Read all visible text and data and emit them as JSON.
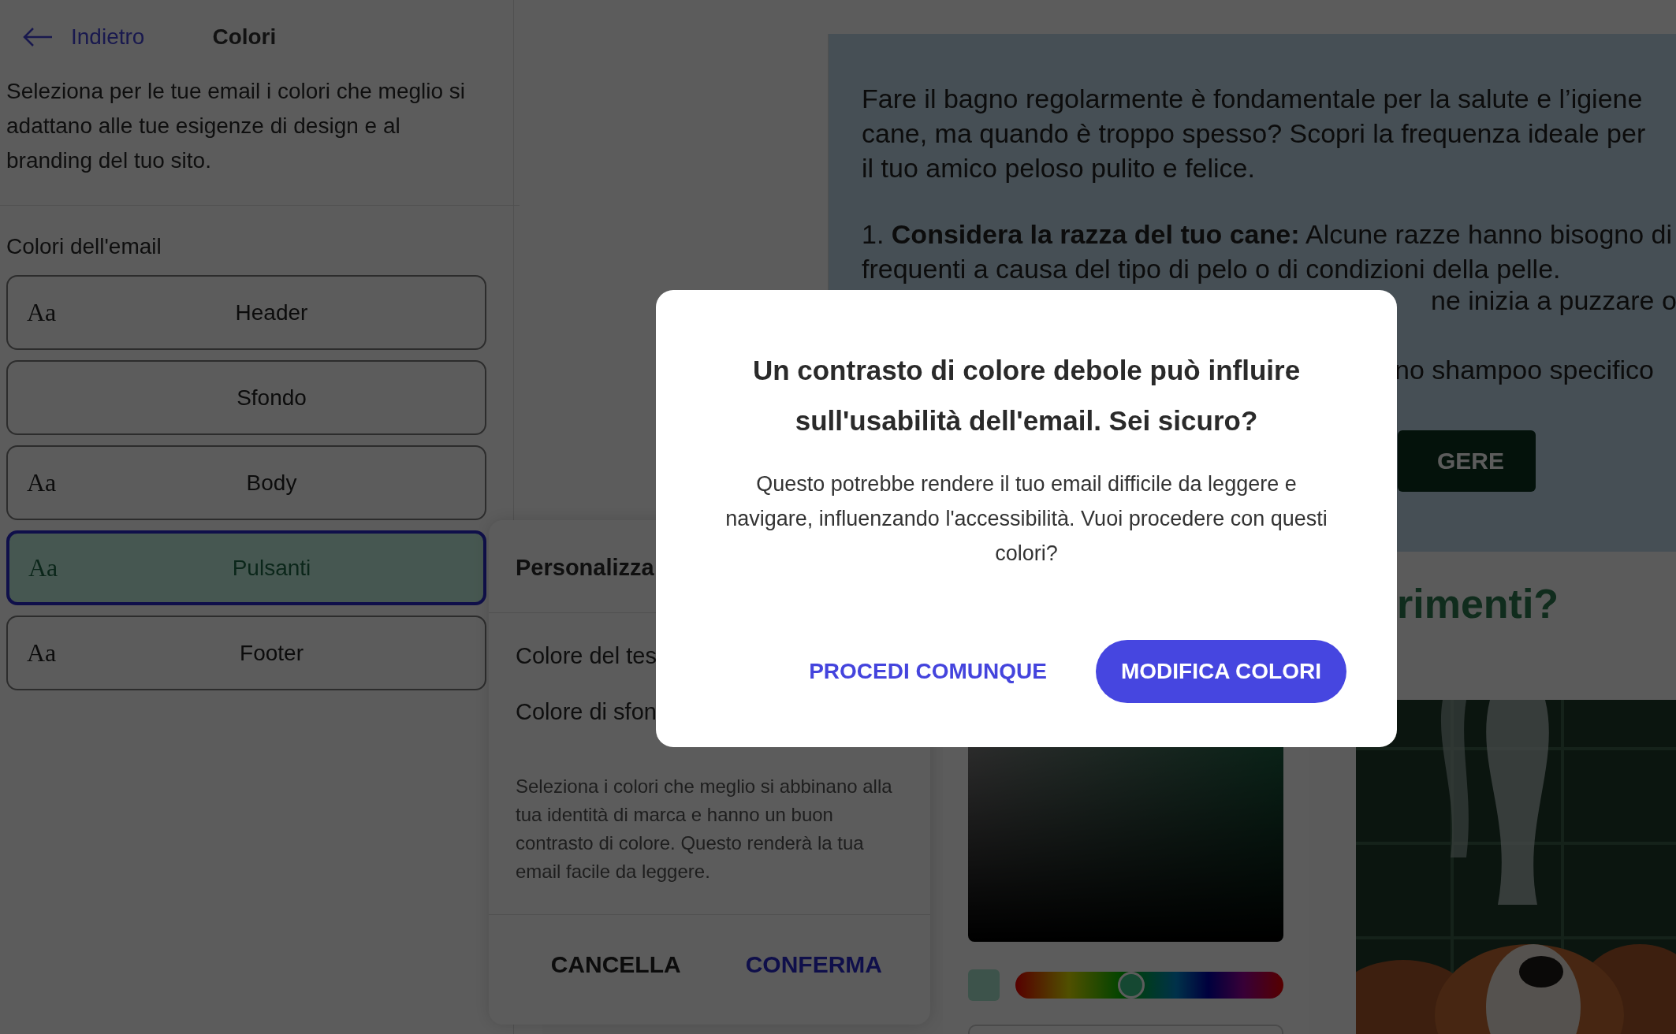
{
  "header": {
    "back": "Indietro",
    "title": "Colori"
  },
  "intro": "Seleziona per le tue email i colori che meglio si adattano alle tue esigenze di design e al branding del tuo sito.",
  "section_title": "Colori dell'email",
  "color_items": [
    {
      "sample": "Aa",
      "label": "Header",
      "selected": false
    },
    {
      "label": "Sfondo",
      "selected": false
    },
    {
      "sample": "Aa",
      "label": "Body",
      "selected": false
    },
    {
      "sample": "Aa",
      "label": "Pulsanti",
      "selected": true
    },
    {
      "sample": "Aa",
      "label": "Footer",
      "selected": false
    }
  ],
  "preview": {
    "lines": [
      "Fare il bagno regolarmente è fondamentale per la salute e l’igiene",
      "cane, ma quando è troppo spesso? Scopri la frequenza ideale per",
      "il tuo amico peloso pulito e felice."
    ],
    "list_lines": [
      "1. **Considera la razza del tuo cane:** Alcune razze hanno bisogno di",
      "frequenti a causa del tipo di pelo o di condizioni della pelle."
    ],
    "fragments": [
      "ne inizia a puzzare o",
      "no shampoo specifico"
    ],
    "button": "GERE",
    "heading": "rimenti?",
    "image": {
      "kind": "picture"
    }
  },
  "customize_panel": {
    "title": "Personalizza",
    "fields": [
      "Colore del tes",
      "Colore di sfon"
    ],
    "hint": "Seleziona i colori che meglio si abbinano alla tua identità di marca e hanno un buon contrasto di colore. Questo renderà la tua email facile da leggere.",
    "buttons": [
      {
        "label": "CANCELLA",
        "kind": "secondary"
      },
      {
        "label": "CONFERMA",
        "kind": "primary"
      }
    ]
  },
  "color_picker": {
    "hue": {
      "level": 0.43
    }
  },
  "dialog": {
    "title": "Un contrasto di colore debole può influire sull'usabilità dell'email. Sei sicuro?",
    "message": "Questo potrebbe rendere il tuo email difficile da leggere e navigare, influenzando l'accessibilità. Vuoi procedere con questi colori?",
    "buttons": [
      {
        "label": "PROCEDI COMUNQUE",
        "kind": "text"
      },
      {
        "label": "MODIFICA COLORI",
        "kind": "primary"
      }
    ]
  }
}
